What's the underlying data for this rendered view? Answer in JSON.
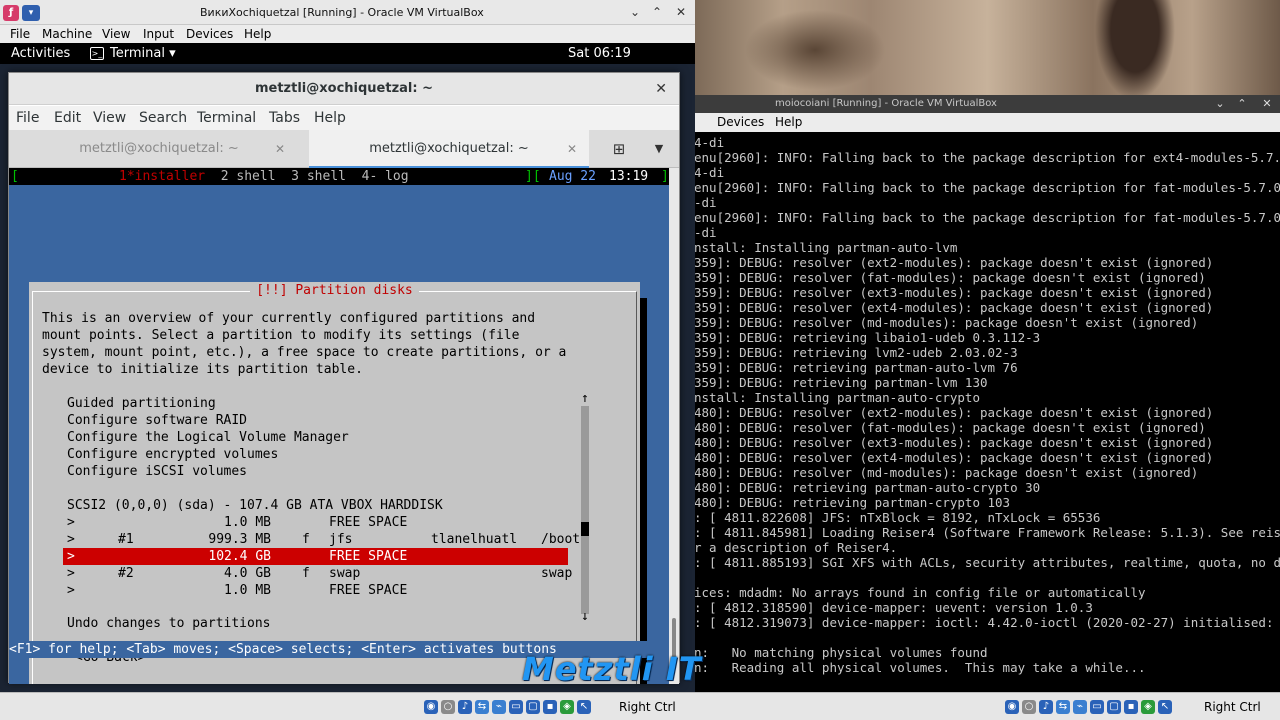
{
  "vm1": {
    "title": "ВикиXochiquetzal [Running] - Oracle VM VirtualBox",
    "menu": [
      "File",
      "Machine",
      "View",
      "Input",
      "Devices",
      "Help"
    ],
    "host_key": "Right Ctrl"
  },
  "gnome": {
    "activities": "Activities",
    "app": "Terminal ▾",
    "clock": "Sat 06:19"
  },
  "terminal": {
    "title": "metztli@xochiquetzal: ~",
    "menu": [
      "File",
      "Edit",
      "View",
      "Search",
      "Terminal",
      "Tabs",
      "Help"
    ],
    "tabs": [
      {
        "label": "metztli@xochiquetzal: ~",
        "active": false
      },
      {
        "label": "metztli@xochiquetzal: ~",
        "active": true
      }
    ]
  },
  "screen": {
    "windows": "1*installer  2 shell  3 shell  4- log",
    "date": "Aug 22",
    "time": "13:19"
  },
  "dialog": {
    "title": "[!!] Partition disks",
    "intro": [
      "This is an overview of your currently configured partitions and",
      "mount points. Select a partition to modify its settings (file",
      "system, mount point, etc.), a free space to create partitions, or a",
      "device to initialize its partition table."
    ],
    "options": [
      "Guided partitioning",
      "Configure software RAID",
      "Configure the Logical Volume Manager",
      "Configure encrypted volumes",
      "Configure iSCSI volumes"
    ],
    "disk": "SCSI2 (0,0,0) (sda) - 107.4 GB ATA VBOX HARDDISK",
    "partitions": [
      {
        "marker": ">",
        "num": "",
        "size": "1.0 MB",
        "flag": "",
        "fs": "FREE SPACE",
        "label": "",
        "mount": "",
        "selected": false
      },
      {
        "marker": ">",
        "num": "#1",
        "size": "999.3 MB",
        "flag": "f",
        "fs": "jfs",
        "label": "tlanelhuatl",
        "mount": "/boot",
        "selected": false
      },
      {
        "marker": ">",
        "num": "",
        "size": "102.4 GB",
        "flag": "",
        "fs": "FREE SPACE",
        "label": "",
        "mount": "",
        "selected": true
      },
      {
        "marker": ">",
        "num": "#2",
        "size": "4.0 GB",
        "flag": "f",
        "fs": "swap",
        "label": "",
        "mount": "swap",
        "selected": false
      },
      {
        "marker": ">",
        "num": "",
        "size": "1.0 MB",
        "flag": "",
        "fs": "FREE SPACE",
        "label": "",
        "mount": "",
        "selected": false
      }
    ],
    "undo": "Undo changes to partitions",
    "go_back": "<Go Back>",
    "scroll_up": "↑",
    "scroll_down": "↓"
  },
  "help_line": "<F1> for help; <Tab> moves; <Space> selects; <Enter> activates buttons",
  "watermark": "Metztli IT",
  "vm2": {
    "title": "moiocoiani [Running] - Oracle VM VirtualBox",
    "menu": [
      "Devices",
      "Help"
    ],
    "host_key": "Right Ctrl",
    "console": [
      "4-di",
      "enu[2960]: INFO: Falling back to the package description for ext4-modules-5.7.",
      "4-di",
      "enu[2960]: INFO: Falling back to the package description for fat-modules-5.7.0",
      "-di",
      "enu[2960]: INFO: Falling back to the package description for fat-modules-5.7.0",
      "-di",
      "nstall: Installing partman-auto-lvm",
      "359]: DEBUG: resolver (ext2-modules): package doesn't exist (ignored)",
      "359]: DEBUG: resolver (fat-modules): package doesn't exist (ignored)",
      "359]: DEBUG: resolver (ext3-modules): package doesn't exist (ignored)",
      "359]: DEBUG: resolver (ext4-modules): package doesn't exist (ignored)",
      "359]: DEBUG: resolver (md-modules): package doesn't exist (ignored)",
      "359]: DEBUG: retrieving libaio1-udeb 0.3.112-3",
      "359]: DEBUG: retrieving lvm2-udeb 2.03.02-3",
      "359]: DEBUG: retrieving partman-auto-lvm 76",
      "359]: DEBUG: retrieving partman-lvm 130",
      "nstall: Installing partman-auto-crypto",
      "480]: DEBUG: resolver (ext2-modules): package doesn't exist (ignored)",
      "480]: DEBUG: resolver (fat-modules): package doesn't exist (ignored)",
      "480]: DEBUG: resolver (ext3-modules): package doesn't exist (ignored)",
      "480]: DEBUG: resolver (ext4-modules): package doesn't exist (ignored)",
      "480]: DEBUG: resolver (md-modules): package doesn't exist (ignored)",
      "480]: DEBUG: retrieving partman-auto-crypto 30",
      "480]: DEBUG: retrieving partman-crypto 103",
      ": [ 4811.822608] JFS: nTxBlock = 8192, nTxLock = 65536",
      ": [ 4811.845981] Loading Reiser4 (Software Framework Release: 5.1.3). See reis",
      "r a description of Reiser4.",
      ": [ 4811.885193] SGI XFS with ACLs, security attributes, realtime, quota, no d",
      "",
      "ices: mdadm: No arrays found in config file or automatically",
      ": [ 4812.318590] device-mapper: uevent: version 1.0.3",
      ": [ 4812.319073] device-mapper: ioctl: 4.42.0-ioctl (2020-02-27) initialised:",
      "",
      "n:   No matching physical volumes found",
      "n:   Reading all physical volumes.  This may take a while..."
    ]
  }
}
